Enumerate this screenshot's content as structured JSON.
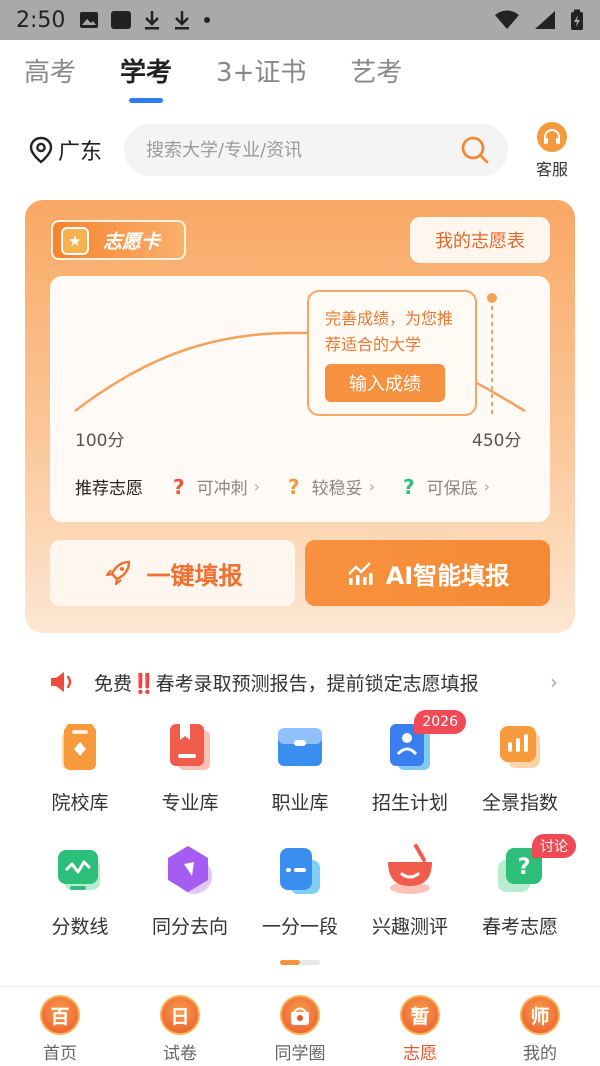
{
  "status_bar": {
    "time": "2:50"
  },
  "tabs": [
    {
      "label": "高考",
      "active": false
    },
    {
      "label": "学考",
      "active": true
    },
    {
      "label": "3+证书",
      "active": false
    },
    {
      "label": "艺考",
      "active": false
    }
  ],
  "location": "广东",
  "search": {
    "placeholder": "搜索大学/专业/资讯"
  },
  "service_label": "客服",
  "card": {
    "badge": "志愿卡",
    "my_table": "我的志愿表",
    "tooltip_text": "完善成绩，为您推荐适合的大学",
    "tooltip_button": "输入成绩",
    "score_min": "100分",
    "score_max": "450分",
    "rec_title": "推荐志愿",
    "rec_items": [
      {
        "mark": "?",
        "label": "可冲刺",
        "color": "#e8563a"
      },
      {
        "mark": "?",
        "label": "较稳妥",
        "color": "#f29a3b"
      },
      {
        "mark": "?",
        "label": "可保底",
        "color": "#2dbf8a"
      }
    ],
    "btn_one_key": "一键填报",
    "btn_ai": "AI智能填报"
  },
  "notice": {
    "text": "免费‼️春考录取预测报告，提前锁定志愿填报"
  },
  "grid": [
    {
      "label": "院校库",
      "icon": "school-icon",
      "color": "#f79a3c"
    },
    {
      "label": "专业库",
      "icon": "book-icon",
      "color": "#f05c4c"
    },
    {
      "label": "职业库",
      "icon": "briefcase-icon",
      "color": "#3a8ef0"
    },
    {
      "label": "招生计划",
      "icon": "plan-icon",
      "color": "#3a7ef0",
      "tag": "2026"
    },
    {
      "label": "全景指数",
      "icon": "index-icon",
      "color": "#f79a3c"
    },
    {
      "label": "分数线",
      "icon": "trend-icon",
      "color": "#2dbf7a"
    },
    {
      "label": "同分去向",
      "icon": "hexagon-icon",
      "color": "#a55cf0"
    },
    {
      "label": "一分一段",
      "icon": "segment-icon",
      "color": "#3a8ef0"
    },
    {
      "label": "兴趣测评",
      "icon": "cup-icon",
      "color": "#f05c4c"
    },
    {
      "label": "春考志愿",
      "icon": "question-icon",
      "color": "#2dbf7a",
      "tag": "讨论"
    }
  ],
  "bottom_nav": [
    {
      "glyph": "百",
      "label": "首页",
      "active": false
    },
    {
      "glyph": "日",
      "label": "试卷",
      "active": false
    },
    {
      "glyph": "",
      "label": "同学圈",
      "active": false
    },
    {
      "glyph": "暂",
      "label": "志愿",
      "active": true
    },
    {
      "glyph": "师",
      "label": "我的",
      "active": false
    }
  ]
}
